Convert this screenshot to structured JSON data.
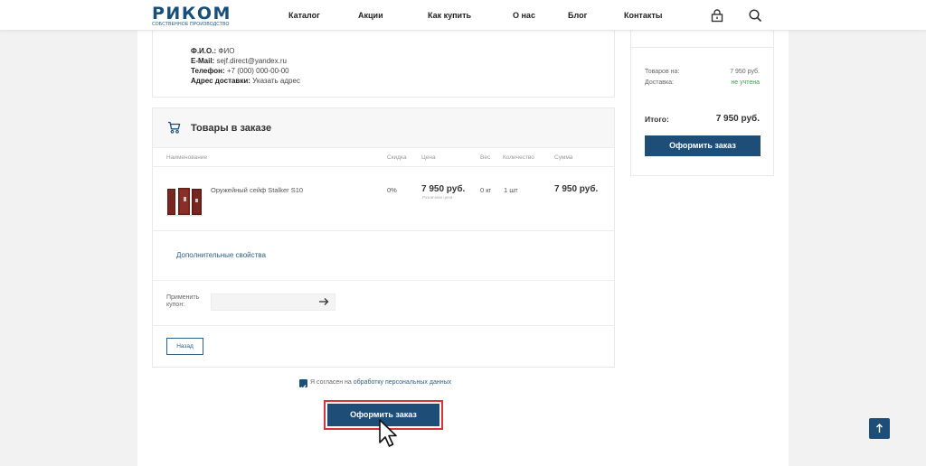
{
  "header": {
    "logo": "РИКОМ",
    "logo_sub": "Собственное производство",
    "nav": [
      "Каталог",
      "Акции",
      "Как купить",
      "О нас",
      "Блог",
      "Контакты"
    ],
    "icons": [
      "lock-icon",
      "search-icon"
    ]
  },
  "contacts": {
    "fio_label": "Ф.И.О.:",
    "fio_value": "ФИО",
    "email_label": "E-Mail:",
    "email_value": "sejf.direct@yandex.ru",
    "phone_label": "Телефон:",
    "phone_value": "+7 (000) 000-00-00",
    "address_label": "Адрес доставки:",
    "address_value": "Указать адрес"
  },
  "order": {
    "title": "Товары в заказе",
    "columns": {
      "name": "Наименование",
      "discount": "Скидка",
      "price": "Цена",
      "weight": "Вес",
      "qty": "Количество",
      "sum": "Сумма"
    },
    "item": {
      "name": "Оружейный сейф Stalker S10",
      "discount": "0%",
      "price": "7 950 руб.",
      "price_note": "Розничная цена",
      "weight": "0 кг",
      "qty": "1 шт",
      "sum": "7 950 руб."
    },
    "extra_link": "Дополнительные свойства",
    "coupon_label": "Применить купон:",
    "coupon_value": "",
    "back_label": "Назад"
  },
  "consent": {
    "text": "Я согласен на",
    "link": "обработку персональных данных",
    "checked": true
  },
  "submit_label": "Оформить заказ",
  "summary": {
    "goods_label": "Товаров на:",
    "goods_value": "7 950 руб.",
    "delivery_label": "Доставка:",
    "delivery_value": "не учтена",
    "total_label": "Итого:",
    "total_value": "7 950 руб.",
    "button_label": "Оформить заказ"
  },
  "colors": {
    "brand": "#1e4d78",
    "highlight": "#d6333b",
    "green": "#3aa14a"
  }
}
